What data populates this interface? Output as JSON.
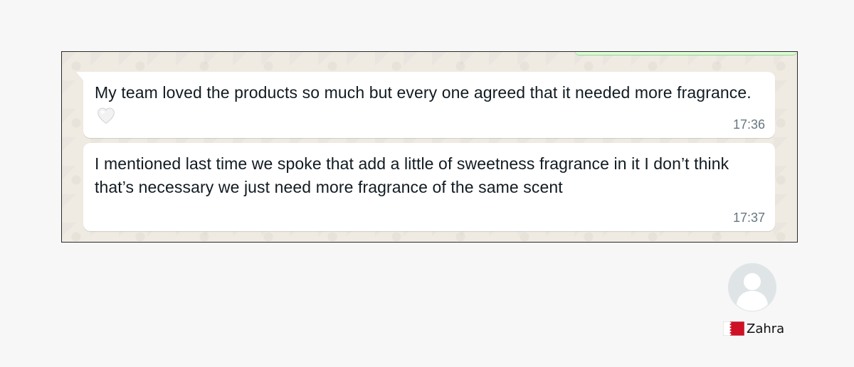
{
  "messages": [
    {
      "text": "My team loved the products so much but every one agreed that it needed more fragrance.",
      "emoji": "white-heart-icon",
      "time": "17:36"
    },
    {
      "text": "I mentioned last time we spoke that add a little of sweetness fragrance in it I don’t think that’s necessary we just need more fragrance of the same scent",
      "time": "17:37"
    }
  ],
  "contact": {
    "name": "Zahra",
    "flag": "bahrain-flag-icon",
    "avatar": "default-avatar-icon"
  },
  "colors": {
    "chat_background": "#efeae2",
    "incoming_bubble": "#ffffff",
    "outgoing_bubble": "#d9fdd3",
    "timestamp": "#667781",
    "flag_red": "#ce1126"
  }
}
